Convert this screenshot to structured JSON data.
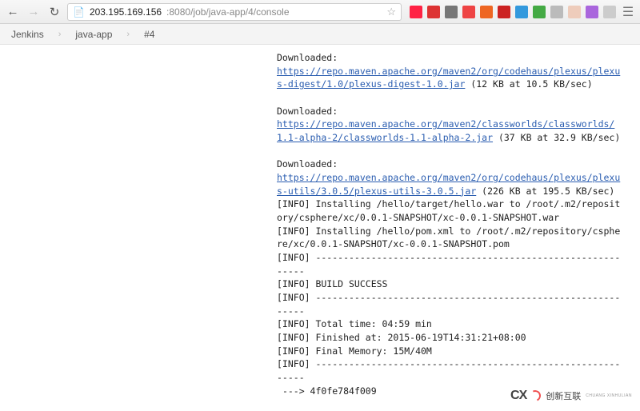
{
  "browser": {
    "url_host": "203.195.169.156",
    "url_rest": ":8080/job/java-app/4/console"
  },
  "breadcrumb": {
    "items": [
      "Jenkins",
      "java-app",
      "#4"
    ]
  },
  "console": {
    "d1_label": "Downloaded:",
    "d1_link": "https://repo.maven.apache.org/maven2/org/codehaus/plexus/plexus-digest/1.0/plexus-digest-1.0.jar",
    "d1_meta": " (12 KB at 10.5 KB/sec)",
    "d2_label": "Downloaded:",
    "d2_link": "https://repo.maven.apache.org/maven2/classworlds/classworlds/1.1-alpha-2/classworlds-1.1-alpha-2.jar",
    "d2_meta": " (37 KB at 32.9 KB/sec)",
    "d3_label": "Downloaded:",
    "d3_link": "https://repo.maven.apache.org/maven2/org/codehaus/plexus/plexus-utils/3.0.5/plexus-utils-3.0.5.jar",
    "d3_meta": " (226 KB at 195.5 KB/sec)",
    "install1": "[INFO] Installing /hello/target/hello.war to /root/.m2/repository/csphere/xc/0.0.1-SNAPSHOT/xc-0.0.1-SNAPSHOT.war",
    "install2": "[INFO] Installing /hello/pom.xml to /root/.m2/repository/csphere/xc/0.0.1-SNAPSHOT/xc-0.0.1-SNAPSHOT.pom",
    "sep1": "[INFO] ------------------------------------------------------------",
    "build": "[INFO] BUILD SUCCESS",
    "sep2": "[INFO] ------------------------------------------------------------",
    "time": "[INFO] Total time: 04:59 min",
    "finished": "[INFO] Finished at: 2015-06-19T14:31:21+08:00",
    "memory": "[INFO] Final Memory: 15M/40M",
    "sep3": "[INFO] ------------------------------------------------------------",
    "hash": " ---> 4f0fe784f009"
  },
  "watermark": {
    "cx": "CX",
    "zh": "创新互联",
    "sub": "CHUANG XINHULIAN"
  }
}
